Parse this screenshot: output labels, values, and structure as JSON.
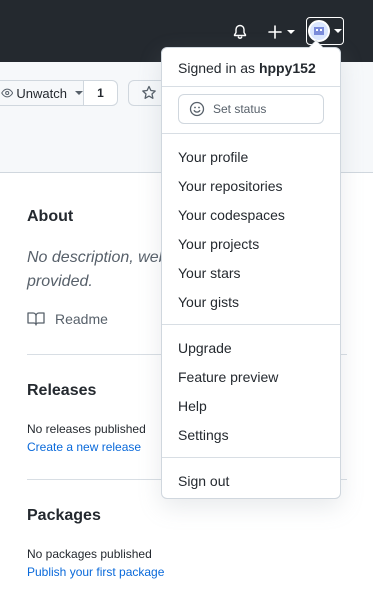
{
  "header": {
    "icons": [
      "bell-icon",
      "plus-icon",
      "avatar"
    ]
  },
  "repo_actions": {
    "unwatch_label": "Unwatch",
    "watch_count": "1"
  },
  "about": {
    "title": "About",
    "description": "No description, web",
    "description_line2": "provided.",
    "readme_label": "Readme"
  },
  "releases": {
    "title": "Releases",
    "none_text": "No releases published",
    "create_link": "Create a new release"
  },
  "packages": {
    "title": "Packages",
    "none_text": "No packages published",
    "publish_link": "Publish your first package"
  },
  "user_menu": {
    "signed_in_prefix": "Signed in as",
    "username": "hppy152",
    "set_status": "Set status",
    "group1": [
      "Your profile",
      "Your repositories",
      "Your codespaces",
      "Your projects",
      "Your stars",
      "Your gists"
    ],
    "group2": [
      "Upgrade",
      "Feature preview",
      "Help",
      "Settings"
    ],
    "sign_out": "Sign out"
  },
  "colors": {
    "topbar": "#24292f",
    "link": "#0969da",
    "border": "#d0d7de"
  }
}
